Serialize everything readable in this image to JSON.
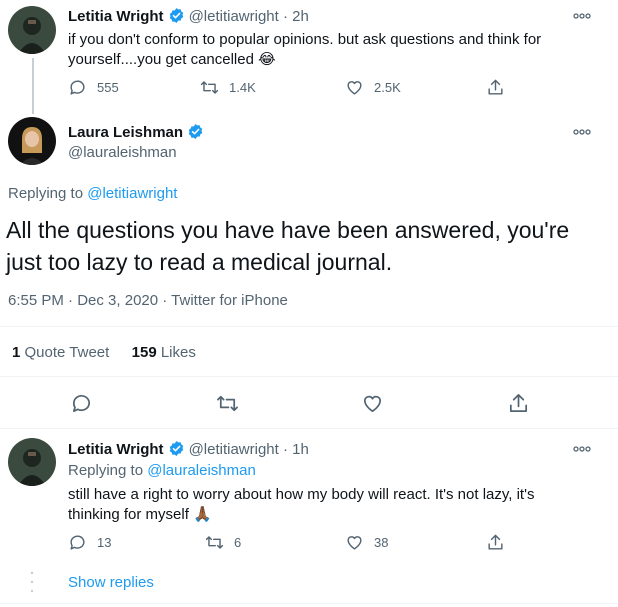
{
  "tweet1": {
    "display_name": "Letitia Wright",
    "handle": "@letitiawright",
    "time": "· 2h",
    "text": "if you don't conform to popular opinions. but ask questions and think for yourself....you get cancelled 😂",
    "reply_count": "555",
    "retweet_count": "1.4K",
    "like_count": "2.5K"
  },
  "main_tweet": {
    "display_name": "Laura Leishman",
    "handle": "@lauraleishman",
    "replying_prefix": "Replying to ",
    "replying_to": "@letitiawright",
    "text": "All the questions you have have been answered, you're just too lazy to read a medical journal.",
    "time": "6:55 PM",
    "date": "Dec 3, 2020",
    "source": "Twitter for iPhone",
    "meta_sep": " · ",
    "quote_count": "1",
    "quote_label": "Quote Tweet",
    "like_count": "159",
    "like_label": "Likes"
  },
  "reply": {
    "display_name": "Letitia Wright",
    "handle": "@letitiawright",
    "time": "· 1h",
    "replying_prefix": "Replying to ",
    "replying_to": "@lauraleishman",
    "text": "still have a right to worry about how my body will react. It's not lazy, it's thinking for myself 🙏🏾",
    "reply_count": "13",
    "retweet_count": "6",
    "like_count": "38",
    "show_replies": "Show replies"
  },
  "colors": {
    "accent": "#1d9bf0",
    "secondary_text": "#536471",
    "divider": "#eff3f4"
  }
}
